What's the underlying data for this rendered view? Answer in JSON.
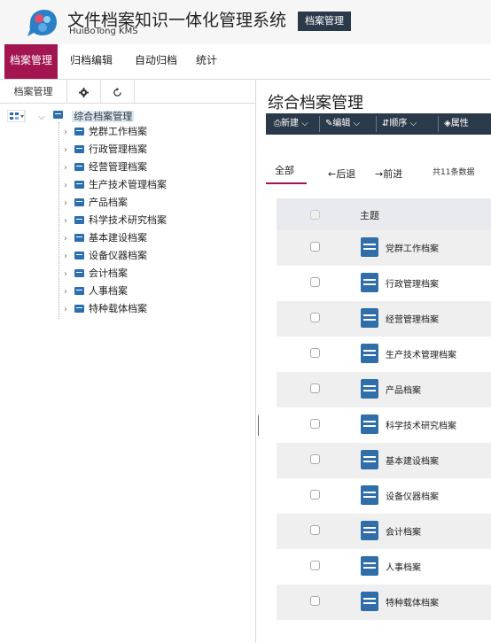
{
  "header": {
    "title": "文件档案知识一体化管理系统",
    "subtitle": "HuiBoTong KMS",
    "module_badge": "档案管理",
    "logo_icon": "huibotong-logo-icon"
  },
  "nav": {
    "items": [
      {
        "label": "档案管理",
        "active": true
      },
      {
        "label": "归档编辑",
        "active": false
      },
      {
        "label": "自动归档",
        "active": false
      },
      {
        "label": "统计",
        "active": false
      }
    ]
  },
  "left_panel": {
    "tabs": [
      {
        "label": "档案管理"
      },
      {
        "icon": "gear-icon"
      },
      {
        "icon": "refresh-icon"
      }
    ],
    "tree": {
      "root_label": "综合档案管理",
      "children": [
        "党群工作档案",
        "行政管理档案",
        "经营管理档案",
        "生产技术管理档案",
        "产品档案",
        "科学技术研究档案",
        "基本建设档案",
        "设备仪器档案",
        "会计档案",
        "人事档案",
        "特种载体档案"
      ]
    }
  },
  "main": {
    "title": "综合档案管理",
    "toolbar": {
      "new_label": "新建",
      "edit_label": "编辑",
      "order_label": "顺序",
      "props_label": "属性"
    },
    "subbar": {
      "all_label": "全部",
      "back_label": "←后退",
      "forward_label": "→前进",
      "count_label": "共11条数据"
    },
    "table": {
      "header_label": "主题",
      "rows": [
        "党群工作档案",
        "行政管理档案",
        "经营管理档案",
        "生产技术管理档案",
        "产品档案",
        "科学技术研究档案",
        "基本建设档案",
        "设备仪器档案",
        "会计档案",
        "人事档案",
        "特种载体档案"
      ]
    }
  },
  "colors": {
    "accent": "#a31551",
    "toolbar_bg": "#2b3a4a",
    "icon_blue": "#2f6ea8"
  }
}
